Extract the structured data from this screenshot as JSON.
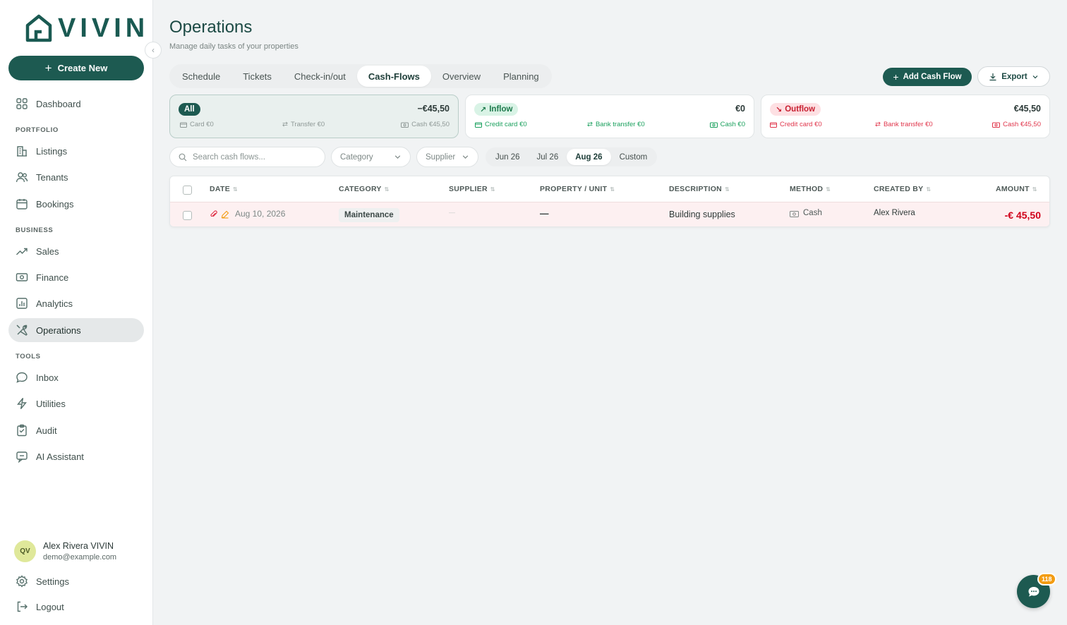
{
  "app": {
    "logo_text": "VIVIN",
    "brand_color": "#1d5a51"
  },
  "sidebar": {
    "create_label": "Create New",
    "items": [
      {
        "label": "Dashboard",
        "icon": "grid-icon"
      },
      {
        "label": "Listings",
        "icon": "building-icon"
      },
      {
        "label": "Tenants",
        "icon": "users-icon"
      },
      {
        "label": "Bookings",
        "icon": "calendar-icon"
      },
      {
        "label": "Sales",
        "icon": "trend-up-icon"
      },
      {
        "label": "Finance",
        "icon": "money-icon"
      },
      {
        "label": "Analytics",
        "icon": "bar-chart-icon"
      },
      {
        "label": "Operations",
        "icon": "tools-icon",
        "active": true
      },
      {
        "label": "Inbox",
        "icon": "chat-icon"
      },
      {
        "label": "Utilities",
        "icon": "bolt-icon"
      },
      {
        "label": "Audit",
        "icon": "clipboard-icon"
      },
      {
        "label": "AI Assistant",
        "icon": "ai-chat-icon"
      }
    ],
    "sections": {
      "portfolio": "PORTFOLIO",
      "business": "BUSINESS",
      "tools": "TOOLS"
    },
    "user": {
      "initials": "QV",
      "name": "Alex Rivera VIVIN",
      "email": "demo@example.com"
    },
    "settings_label": "Settings",
    "logout_label": "Logout"
  },
  "header": {
    "title": "Operations",
    "subtitle": "Manage daily tasks of your properties"
  },
  "tabs": [
    "Schedule",
    "Tickets",
    "Check-in/out",
    "Cash-Flows",
    "Overview",
    "Planning"
  ],
  "active_tab": "Cash-Flows",
  "actions": {
    "add_label": "Add Cash Flow",
    "export_label": "Export"
  },
  "summary": {
    "all": {
      "label": "All",
      "total": "−€45,50",
      "card": "Card €0",
      "transfer": "Transfer €0",
      "cash": "Cash €45,50"
    },
    "inflow": {
      "label": "Inflow",
      "total": "€0",
      "credit": "Credit card €0",
      "bank": "Bank transfer €0",
      "cash": "Cash €0"
    },
    "outflow": {
      "label": "Outflow",
      "total": "€45,50",
      "credit": "Credit card €0",
      "bank": "Bank transfer €0",
      "cash": "Cash €45,50"
    }
  },
  "filters": {
    "search_placeholder": "Search cash flows...",
    "category": "Category",
    "supplier": "Supplier",
    "periods": [
      "Jun 26",
      "Jul 26",
      "Aug 26",
      "Custom"
    ],
    "active_period": "Aug 26"
  },
  "table": {
    "columns": [
      "DATE",
      "CATEGORY",
      "SUPPLIER",
      "PROPERTY / UNIT",
      "DESCRIPTION",
      "METHOD",
      "CREATED BY",
      "AMOUNT"
    ],
    "rows": [
      {
        "date": "Aug 10, 2026",
        "category": "Maintenance",
        "supplier": "—",
        "property": "—",
        "description": "Building supplies",
        "method": "Cash",
        "created_by": "Alex Rivera",
        "amount": "-€ 45,50"
      }
    ]
  },
  "chat": {
    "unread": "118"
  }
}
